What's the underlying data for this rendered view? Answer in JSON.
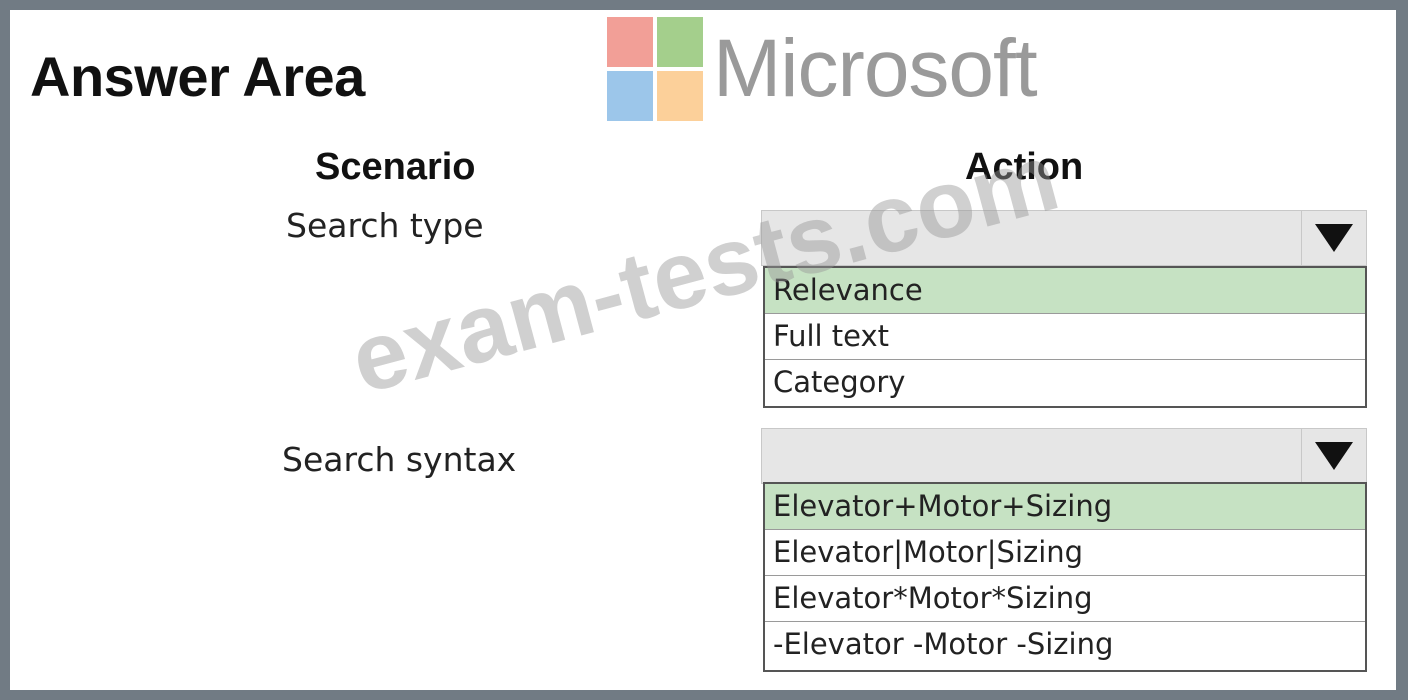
{
  "header": {
    "title": "Answer Area",
    "logo_word": "Microsoft",
    "logo_icon": "microsoft-logo-icon"
  },
  "columns": {
    "scenario": "Scenario",
    "action": "Action"
  },
  "rows": [
    {
      "scenario": "Search type",
      "selected_value": "",
      "options": [
        "Relevance",
        "Full text",
        "Category"
      ],
      "highlighted_option": "Relevance"
    },
    {
      "scenario": "Search syntax",
      "selected_value": "",
      "options": [
        "Elevator+Motor+Sizing",
        "Elevator|Motor|Sizing",
        "Elevator*Motor*Sizing",
        "-Elevator -Motor -Sizing"
      ],
      "highlighted_option": "Elevator+Motor+Sizing"
    }
  ],
  "watermark": "exam-tests.com",
  "colors": {
    "frame_border": "#717b84",
    "highlight": "#c6e2c3",
    "dropdown_bg": "#e6e6e6"
  }
}
